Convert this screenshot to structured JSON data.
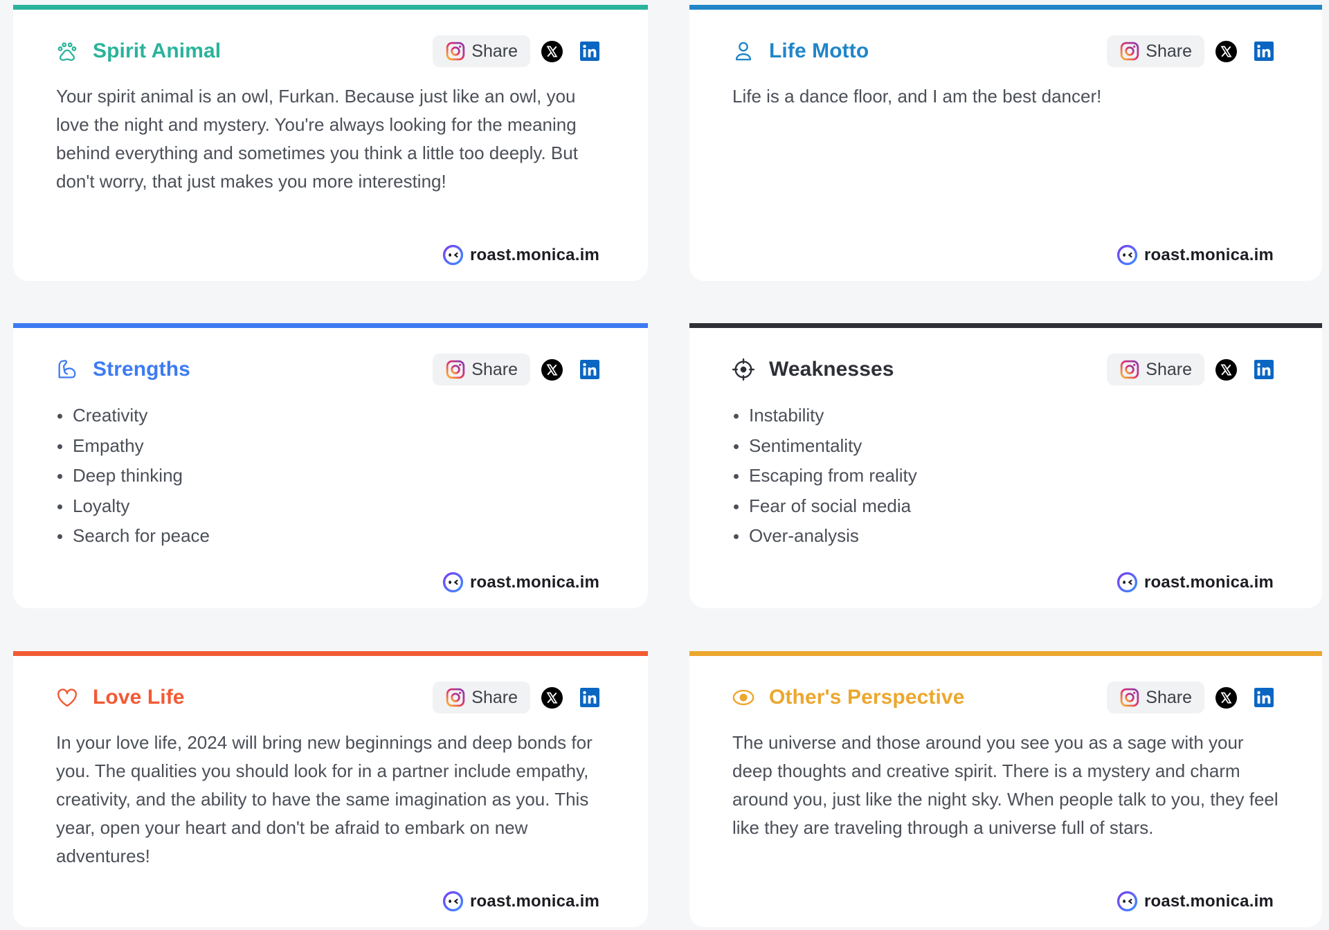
{
  "share_label": "Share",
  "brand_label": "roast.monica.im",
  "cards": [
    {
      "id": "spirit-animal",
      "title": "Spirit Animal",
      "icon": "paw-icon",
      "color": "#2ab39b",
      "text": "Your spirit animal is an owl, Furkan. Because just like an owl, you love the night and mystery. You're always looking for the meaning behind everything and sometimes you think a little too deeply. But don't worry, that just makes you more interesting!"
    },
    {
      "id": "life-motto",
      "title": "Life Motto",
      "icon": "user-icon",
      "color": "#2185c8",
      "text": "Life is a dance floor, and I am the best dancer!"
    },
    {
      "id": "strengths",
      "title": "Strengths",
      "icon": "flexed-arm-icon",
      "color": "#3d7bf2",
      "items": [
        "Creativity",
        "Empathy",
        "Deep thinking",
        "Loyalty",
        "Search for peace"
      ]
    },
    {
      "id": "weaknesses",
      "title": "Weaknesses",
      "icon": "target-icon",
      "color": "#2e3036",
      "items": [
        "Instability",
        "Sentimentality",
        "Escaping from reality",
        "Fear of social media",
        "Over-analysis"
      ]
    },
    {
      "id": "love-life",
      "title": "Love Life",
      "icon": "heart-icon",
      "color": "#f25a34",
      "text": "In your love life, 2024 will bring new beginnings and deep bonds for you. The qualities you should look for in a partner include empathy, creativity, and the ability to have the same imagination as you. This year, open your heart and don't be afraid to embark on new adventures!"
    },
    {
      "id": "others-perspective",
      "title": "Other's Perspective",
      "icon": "eye-icon",
      "color": "#eca72f",
      "text": "The universe and those around you see you as a sage with your deep thoughts and creative spirit. There is a mystery and charm around you, just like the night sky. When people talk to you, they feel like they are traveling through a universe full of stars."
    }
  ]
}
